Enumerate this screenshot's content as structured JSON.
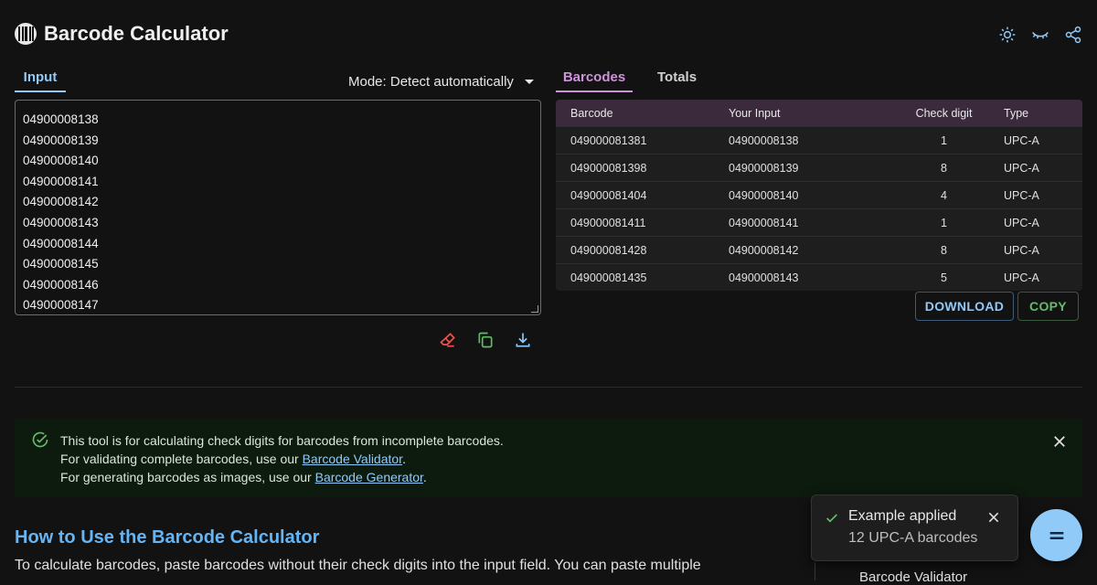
{
  "app": {
    "title": "Barcode Calculator"
  },
  "header_icons": [
    "sun-icon",
    "eye-closed-icon",
    "share-icon"
  ],
  "input_panel": {
    "tab_label": "Input",
    "mode_label": "Mode: Detect automatically",
    "lines": [
      "04900008138",
      "04900008139",
      "04900008140",
      "04900008141",
      "04900008142",
      "04900008143",
      "04900008144",
      "04900008145",
      "04900008146",
      "04900008147"
    ],
    "tool_icons": [
      "eraser-icon",
      "copy-icon",
      "download-icon"
    ]
  },
  "results_panel": {
    "tabs": [
      "Barcodes",
      "Totals"
    ],
    "headers": [
      "Barcode",
      "Your Input",
      "Check digit",
      "Type"
    ],
    "rows": [
      [
        "049000081381",
        "04900008138",
        "1",
        "UPC-A"
      ],
      [
        "049000081398",
        "04900008139",
        "8",
        "UPC-A"
      ],
      [
        "049000081404",
        "04900008140",
        "4",
        "UPC-A"
      ],
      [
        "049000081411",
        "04900008141",
        "1",
        "UPC-A"
      ],
      [
        "049000081428",
        "04900008142",
        "8",
        "UPC-A"
      ],
      [
        "049000081435",
        "04900008143",
        "5",
        "UPC-A"
      ]
    ],
    "download_label": "DOWNLOAD",
    "copy_label": "COPY"
  },
  "info_alert": {
    "line1": "This tool is for calculating check digits for barcodes from incomplete barcodes.",
    "line2_prefix": "For validating complete barcodes, use our ",
    "line2_link": "Barcode Validator",
    "line2_suffix": ".",
    "line3_prefix": "For generating barcodes as images, use our ",
    "line3_link": "Barcode Generator",
    "line3_suffix": "."
  },
  "how_to": {
    "heading": "How to Use the Barcode Calculator",
    "paragraph": "To calculate barcodes, paste barcodes without their check digits into the input field. You can paste multiple"
  },
  "sidebar_cut": {
    "label": "Barcode Validator"
  },
  "toast": {
    "title": "Example applied",
    "message": "12 UPC-A barcodes"
  },
  "colors": {
    "input_accent": "#90caf9",
    "results_accent": "#ce93d8",
    "success": "#66bb6a",
    "danger": "#ef5350"
  }
}
